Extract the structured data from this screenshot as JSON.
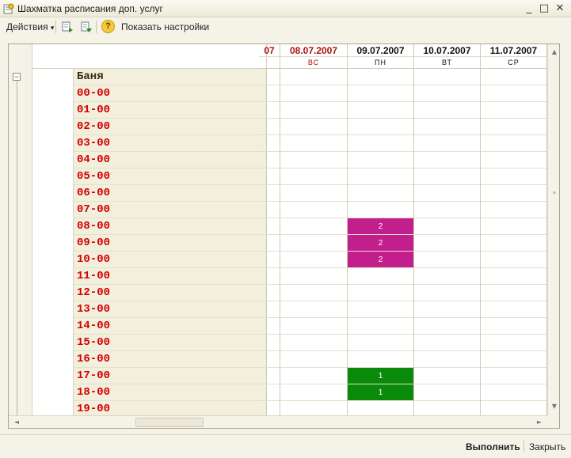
{
  "window": {
    "title": "Шахматка расписания доп. услуг",
    "minimize_glyph": "_",
    "maximize_glyph": "□",
    "close_glyph": "✕"
  },
  "toolbar": {
    "actions_label": "Действия",
    "actions_arrow": "▾",
    "help_glyph": "?",
    "settings_label": "Показать настройки"
  },
  "grid": {
    "group_label": "Баня",
    "collapse_glyph": "−",
    "hours": [
      "00-00",
      "01-00",
      "02-00",
      "03-00",
      "04-00",
      "05-00",
      "06-00",
      "07-00",
      "08-00",
      "09-00",
      "10-00",
      "11-00",
      "12-00",
      "13-00",
      "14-00",
      "15-00",
      "16-00",
      "17-00",
      "18-00",
      "19-00"
    ],
    "columns": [
      {
        "date": "07",
        "day": "",
        "color": "#b01010"
      },
      {
        "date": "08.07.2007",
        "day": "ВС",
        "color": "#b01010"
      },
      {
        "date": "09.07.2007",
        "day": "ПН",
        "color": "#111111"
      },
      {
        "date": "10.07.2007",
        "day": "ВТ",
        "color": "#111111"
      },
      {
        "date": "11.07.2007",
        "day": "СР",
        "color": "#111111"
      }
    ],
    "bookings": [
      {
        "column": 2,
        "hour": "08-00",
        "value": "2",
        "color": "#c21e8c"
      },
      {
        "column": 2,
        "hour": "09-00",
        "value": "2",
        "color": "#c21e8c"
      },
      {
        "column": 2,
        "hour": "10-00",
        "value": "2",
        "color": "#c21e8c"
      },
      {
        "column": 2,
        "hour": "17-00",
        "value": "1",
        "color": "#0a8a0a"
      },
      {
        "column": 2,
        "hour": "18-00",
        "value": "1",
        "color": "#0a8a0a"
      }
    ]
  },
  "scroll": {
    "up_glyph": "▲",
    "down_glyph": "▼",
    "left_glyph": "◄",
    "right_glyph": "►"
  },
  "footer": {
    "execute_label": "Выполнить",
    "close_label": "Закрыть"
  }
}
